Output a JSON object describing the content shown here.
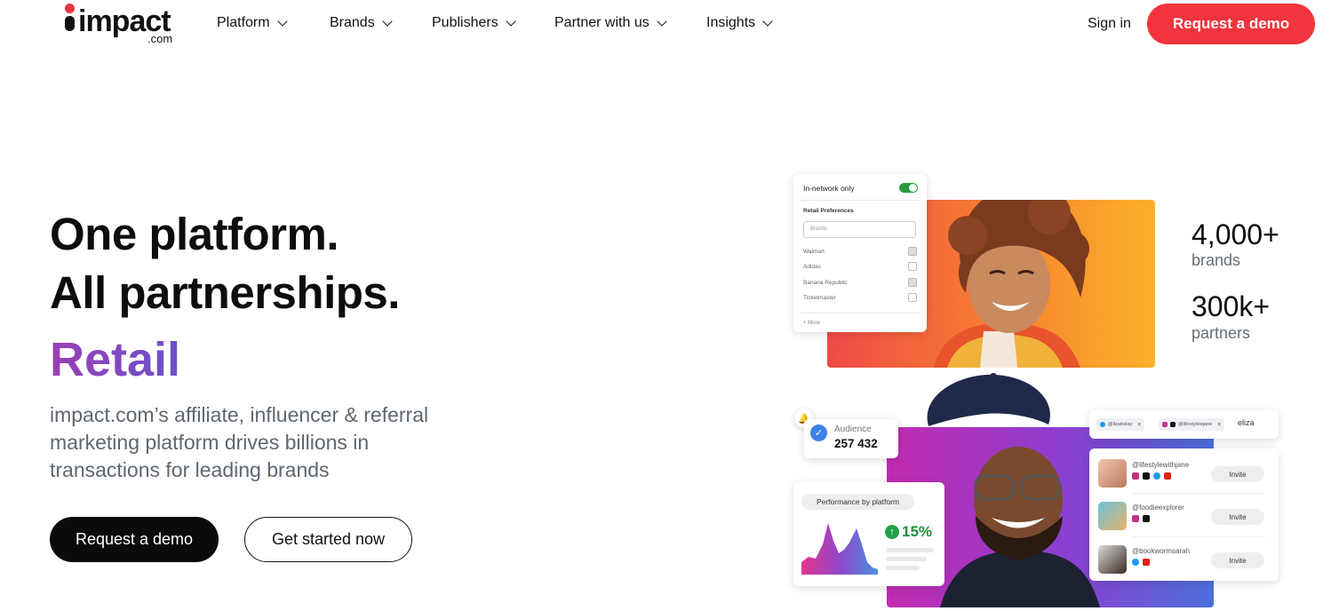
{
  "brand": {
    "name": "impact",
    "suffix": ".com"
  },
  "nav": {
    "items": [
      "Platform",
      "Brands",
      "Publishers",
      "Partner with us",
      "Insights"
    ],
    "sign_in": "Sign in",
    "cta": "Request a demo"
  },
  "hero": {
    "title_line1": "One platform.",
    "title_line2": "All partnerships.",
    "highlight": "Retail",
    "description": "impact.com’s affiliate, influencer & referral marketing platform drives billions in transactions for leading brands",
    "primary_cta": "Request a demo",
    "secondary_cta": "Get started now"
  },
  "filter_panel": {
    "toggle_label": "In-network only",
    "section": "Retail Preferences",
    "search_placeholder": "Brands",
    "brands": [
      {
        "name": "Walmart",
        "checked": true
      },
      {
        "name": "Adidas",
        "checked": false
      },
      {
        "name": "Banana Republic",
        "checked": true
      },
      {
        "name": "Ticketmaster",
        "checked": false
      }
    ],
    "more": "+ More"
  },
  "stats": [
    {
      "value": "4,000+",
      "label": "brands"
    },
    {
      "value": "300k+",
      "label": "partners"
    }
  ],
  "audience": {
    "label": "Audience",
    "value": "257 432"
  },
  "performance": {
    "title": "Performance by platform",
    "change": "15%"
  },
  "search": {
    "tags": [
      "@lizatoday",
      "@lifestylewjane"
    ],
    "typed": "eliza"
  },
  "influencers": [
    {
      "handle": "@lifestylewithjane",
      "action": "Invite"
    },
    {
      "handle": "@foodieexplorer",
      "action": "Invite"
    },
    {
      "handle": "@bookwormsarah",
      "action": "Invite"
    }
  ],
  "colors": {
    "accent": "#f1343e",
    "retail_gradient_start": "#9d3fb6",
    "retail_gradient_end": "#6a52c8",
    "positive": "#24a148"
  }
}
